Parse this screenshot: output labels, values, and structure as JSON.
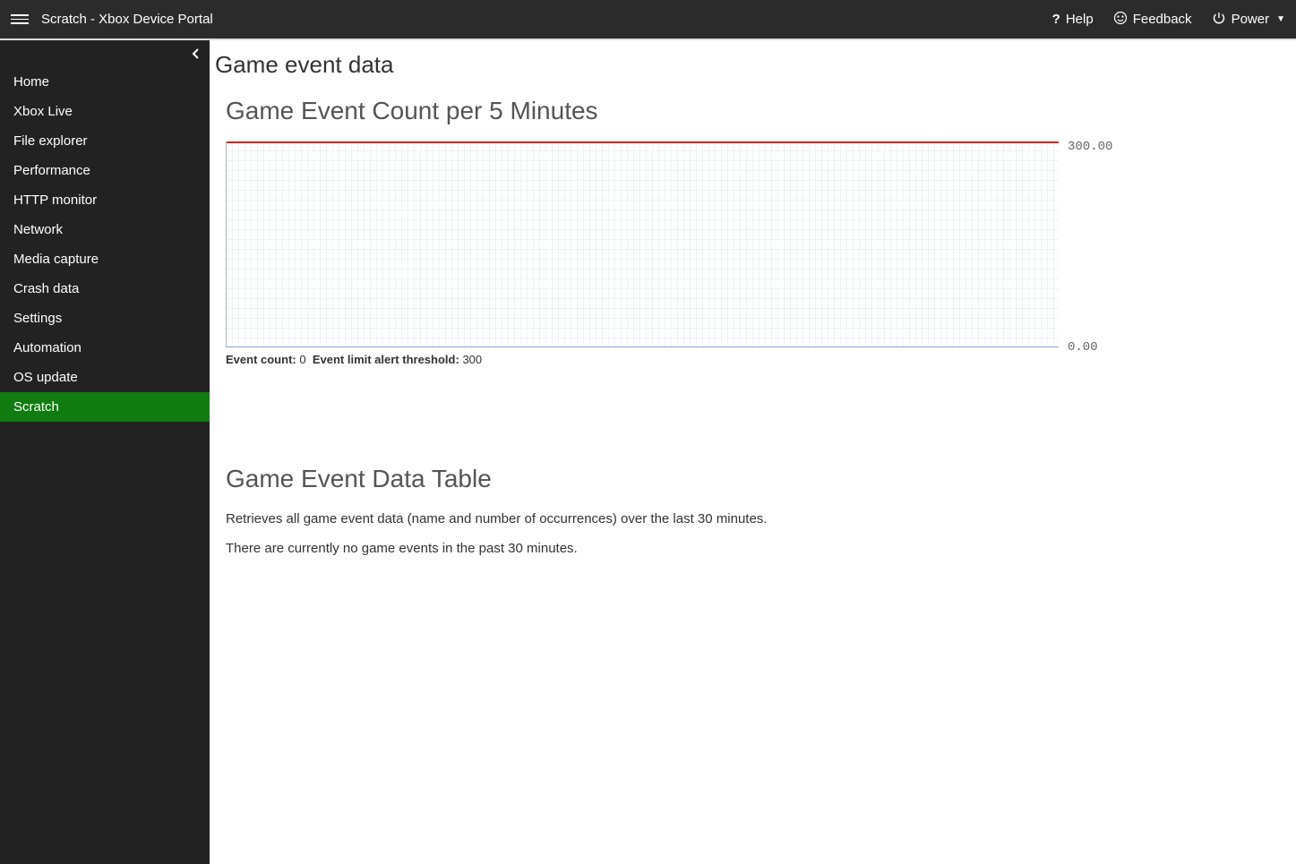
{
  "topbar": {
    "title": "Scratch - Xbox Device Portal",
    "help": "Help",
    "feedback": "Feedback",
    "power": "Power"
  },
  "sidebar": {
    "items": [
      {
        "label": "Home"
      },
      {
        "label": "Xbox Live"
      },
      {
        "label": "File explorer"
      },
      {
        "label": "Performance"
      },
      {
        "label": "HTTP monitor"
      },
      {
        "label": "Network"
      },
      {
        "label": "Media capture"
      },
      {
        "label": "Crash data"
      },
      {
        "label": "Settings"
      },
      {
        "label": "Automation"
      },
      {
        "label": "OS update"
      },
      {
        "label": "Scratch"
      }
    ],
    "active_index": 11
  },
  "page": {
    "title": "Game event data",
    "chart_section_title": "Game Event Count per 5 Minutes",
    "event_count_label": "Event count:",
    "event_count_value": "0",
    "threshold_label": "Event limit alert threshold:",
    "threshold_value": "300",
    "table_section_title": "Game Event Data Table",
    "table_desc": "Retrieves all game event data (name and number of occurrences) over the last 30 minutes.",
    "table_empty": "There are currently no game events in the past 30 minutes."
  },
  "chart_data": {
    "type": "line",
    "title": "Game Event Count per 5 Minutes",
    "xlabel": "",
    "ylabel": "",
    "ylim": [
      0,
      300
    ],
    "y_tick_top": "300.00",
    "y_tick_bottom": "0.00",
    "threshold_line": 300,
    "series": [
      {
        "name": "Event count",
        "values": []
      }
    ]
  }
}
